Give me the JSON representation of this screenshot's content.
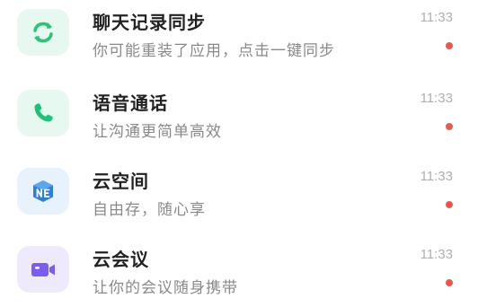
{
  "colors": {
    "badge_red": "#e8584f",
    "sync_tile_bg": "#e6f8ef",
    "sync_icon": "#2bc377",
    "call_tile_bg": "#e6f8ef",
    "call_icon": "#1fc07a",
    "cloud_tile_bg": "#e8f2fc",
    "cloud_icon": "#2f7fd8",
    "meeting_tile_bg": "#efe9fc",
    "meeting_icon": "#7a5cf0"
  },
  "items": [
    {
      "icon": "sync-icon",
      "title": "聊天记录同步",
      "subtitle": "你可能重装了应用，点击一键同步",
      "time": "11:33",
      "unread": true
    },
    {
      "icon": "phone-icon",
      "title": "语音通话",
      "subtitle": "让沟通更简单高效",
      "time": "11:33",
      "unread": true
    },
    {
      "icon": "cloud-drive-icon",
      "title": "云空间",
      "subtitle": "自由存，随心享",
      "time": "11:33",
      "unread": true
    },
    {
      "icon": "video-camera-icon",
      "title": "云会议",
      "subtitle": "让你的会议随身携带",
      "time": "11:33",
      "unread": true
    }
  ]
}
